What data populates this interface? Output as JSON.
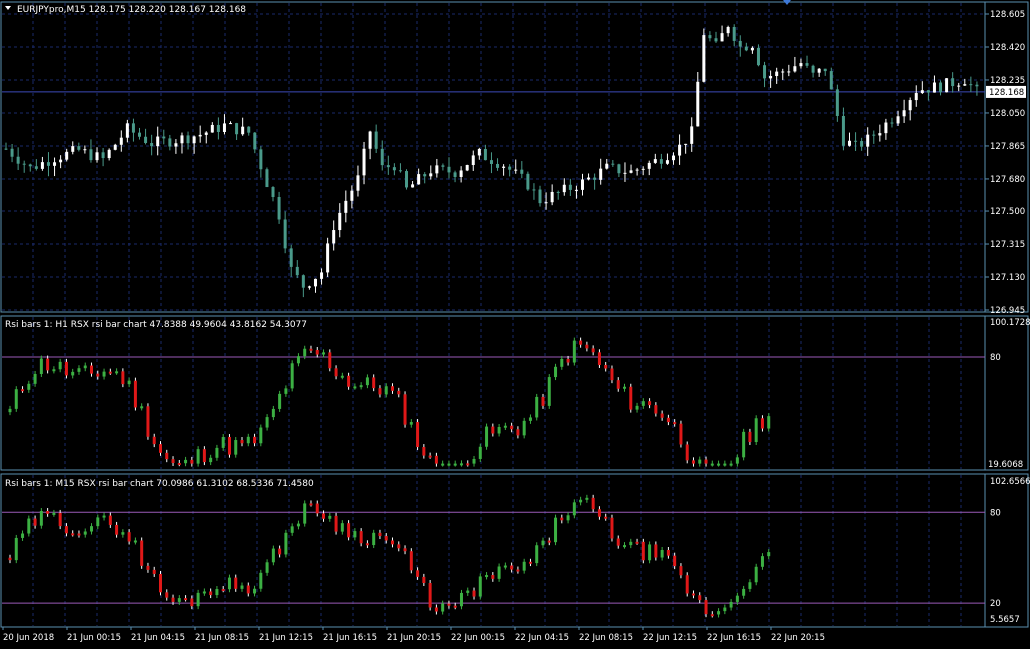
{
  "main": {
    "header": "EURJPYpro,M15  128.175 128.220 128.167 128.168",
    "price_labels": [
      "128.605",
      "128.420",
      "128.235",
      "128.050",
      "127.865",
      "127.680",
      "127.500",
      "127.315",
      "127.130",
      "126.945"
    ],
    "range": [
      126.945,
      128.605
    ],
    "current_price": "128.168",
    "current_value": 128.168
  },
  "rsi_h1": {
    "header": "Rsi bars 1: H1 RSX rsi bar chart 47.8388 49.9604 43.8162 54.3077",
    "top_label": "100.1728",
    "bottom_label": "19.6068",
    "level_label": "80",
    "range": [
      19.6068,
      100.1728
    ],
    "level": 80
  },
  "rsi_m15": {
    "header": "Rsi bars 1: M15 RSX rsi bar chart 70.0986 61.3102 68.5336 71.4580",
    "top_label": "102.6566",
    "bottom_label": "5.5657",
    "level_high_label": "80",
    "level_low_label": "20",
    "range": [
      5.5657,
      102.6566
    ],
    "level_high": 80,
    "level_low": 20
  },
  "time_labels": [
    "20 Jun 2018",
    "21 Jun 00:15",
    "21 Jun 04:15",
    "21 Jun 08:15",
    "21 Jun 12:15",
    "21 Jun 16:15",
    "21 Jun 20:15",
    "22 Jun 00:15",
    "22 Jun 04:15",
    "22 Jun 08:15",
    "22 Jun 12:15",
    "22 Jun 16:15",
    "22 Jun 20:15"
  ],
  "colors": {
    "background": "#000000",
    "grid": "#1a2a6a",
    "frame": "#5a8fb0",
    "bull_candle": "#ffffff",
    "bear_candle": "#4a9a8a",
    "level_line": "#9a5ab8",
    "rsi_up": "#3cb043",
    "rsi_down": "#e01818",
    "text": "#ffffff"
  },
  "chart_data": {
    "type": "candlestick",
    "symbol": "EURJPYpro",
    "timeframe": "M15",
    "last_close": 128.168,
    "ylim": [
      126.945,
      128.605
    ],
    "close_path": [
      [
        0,
        127.85
      ],
      [
        4,
        127.74
      ],
      [
        8,
        127.8
      ],
      [
        12,
        127.84
      ],
      [
        16,
        127.79
      ],
      [
        20,
        127.96
      ],
      [
        24,
        127.88
      ],
      [
        28,
        127.9
      ],
      [
        32,
        127.93
      ],
      [
        36,
        127.98
      ],
      [
        40,
        127.94
      ],
      [
        43,
        127.66
      ],
      [
        45,
        127.48
      ],
      [
        47,
        127.17
      ],
      [
        49,
        127.08
      ],
      [
        52,
        127.16
      ],
      [
        54,
        127.42
      ],
      [
        56,
        127.56
      ],
      [
        58,
        127.68
      ],
      [
        60,
        127.95
      ],
      [
        62,
        127.74
      ],
      [
        64,
        127.76
      ],
      [
        66,
        127.62
      ],
      [
        70,
        127.73
      ],
      [
        74,
        127.72
      ],
      [
        78,
        127.82
      ],
      [
        82,
        127.76
      ],
      [
        86,
        127.65
      ],
      [
        88,
        127.56
      ],
      [
        91,
        127.6
      ],
      [
        95,
        127.66
      ],
      [
        99,
        127.74
      ],
      [
        103,
        127.72
      ],
      [
        107,
        127.78
      ],
      [
        111,
        127.86
      ],
      [
        113,
        127.94
      ],
      [
        115,
        128.5
      ],
      [
        117,
        128.42
      ],
      [
        119,
        128.55
      ],
      [
        121,
        128.42
      ],
      [
        123,
        128.44
      ],
      [
        125,
        128.25
      ],
      [
        127,
        128.27
      ],
      [
        129,
        128.3
      ],
      [
        131,
        128.33
      ],
      [
        133,
        128.26
      ],
      [
        135,
        128.3
      ],
      [
        138,
        127.9
      ],
      [
        140,
        127.86
      ],
      [
        142,
        127.9
      ],
      [
        146,
        128.02
      ],
      [
        150,
        128.18
      ],
      [
        154,
        128.2
      ],
      [
        158,
        128.24
      ],
      [
        160,
        128.168
      ]
    ]
  }
}
